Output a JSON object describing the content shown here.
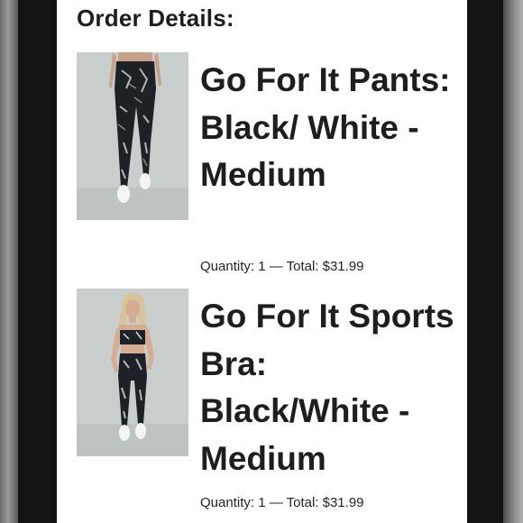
{
  "order": {
    "heading": "Order Details:",
    "items": [
      {
        "title": "Go For It Pants: Black/ White - Medium",
        "quantity_text": "Quantity: 1 — Total: $31.99",
        "image_icon": "leggings-product-photo"
      },
      {
        "title": "Go For It Sports Bra: Black/White - Medium",
        "quantity_text": "Quantity: 1 — Total: $31.99",
        "image_icon": "sports-bra-product-photo"
      }
    ]
  },
  "colors": {
    "background_frame": "#141414",
    "screen_background": "#ffffff",
    "text_primary": "#1e1e1e",
    "photo_background": "#c9cfcd"
  }
}
